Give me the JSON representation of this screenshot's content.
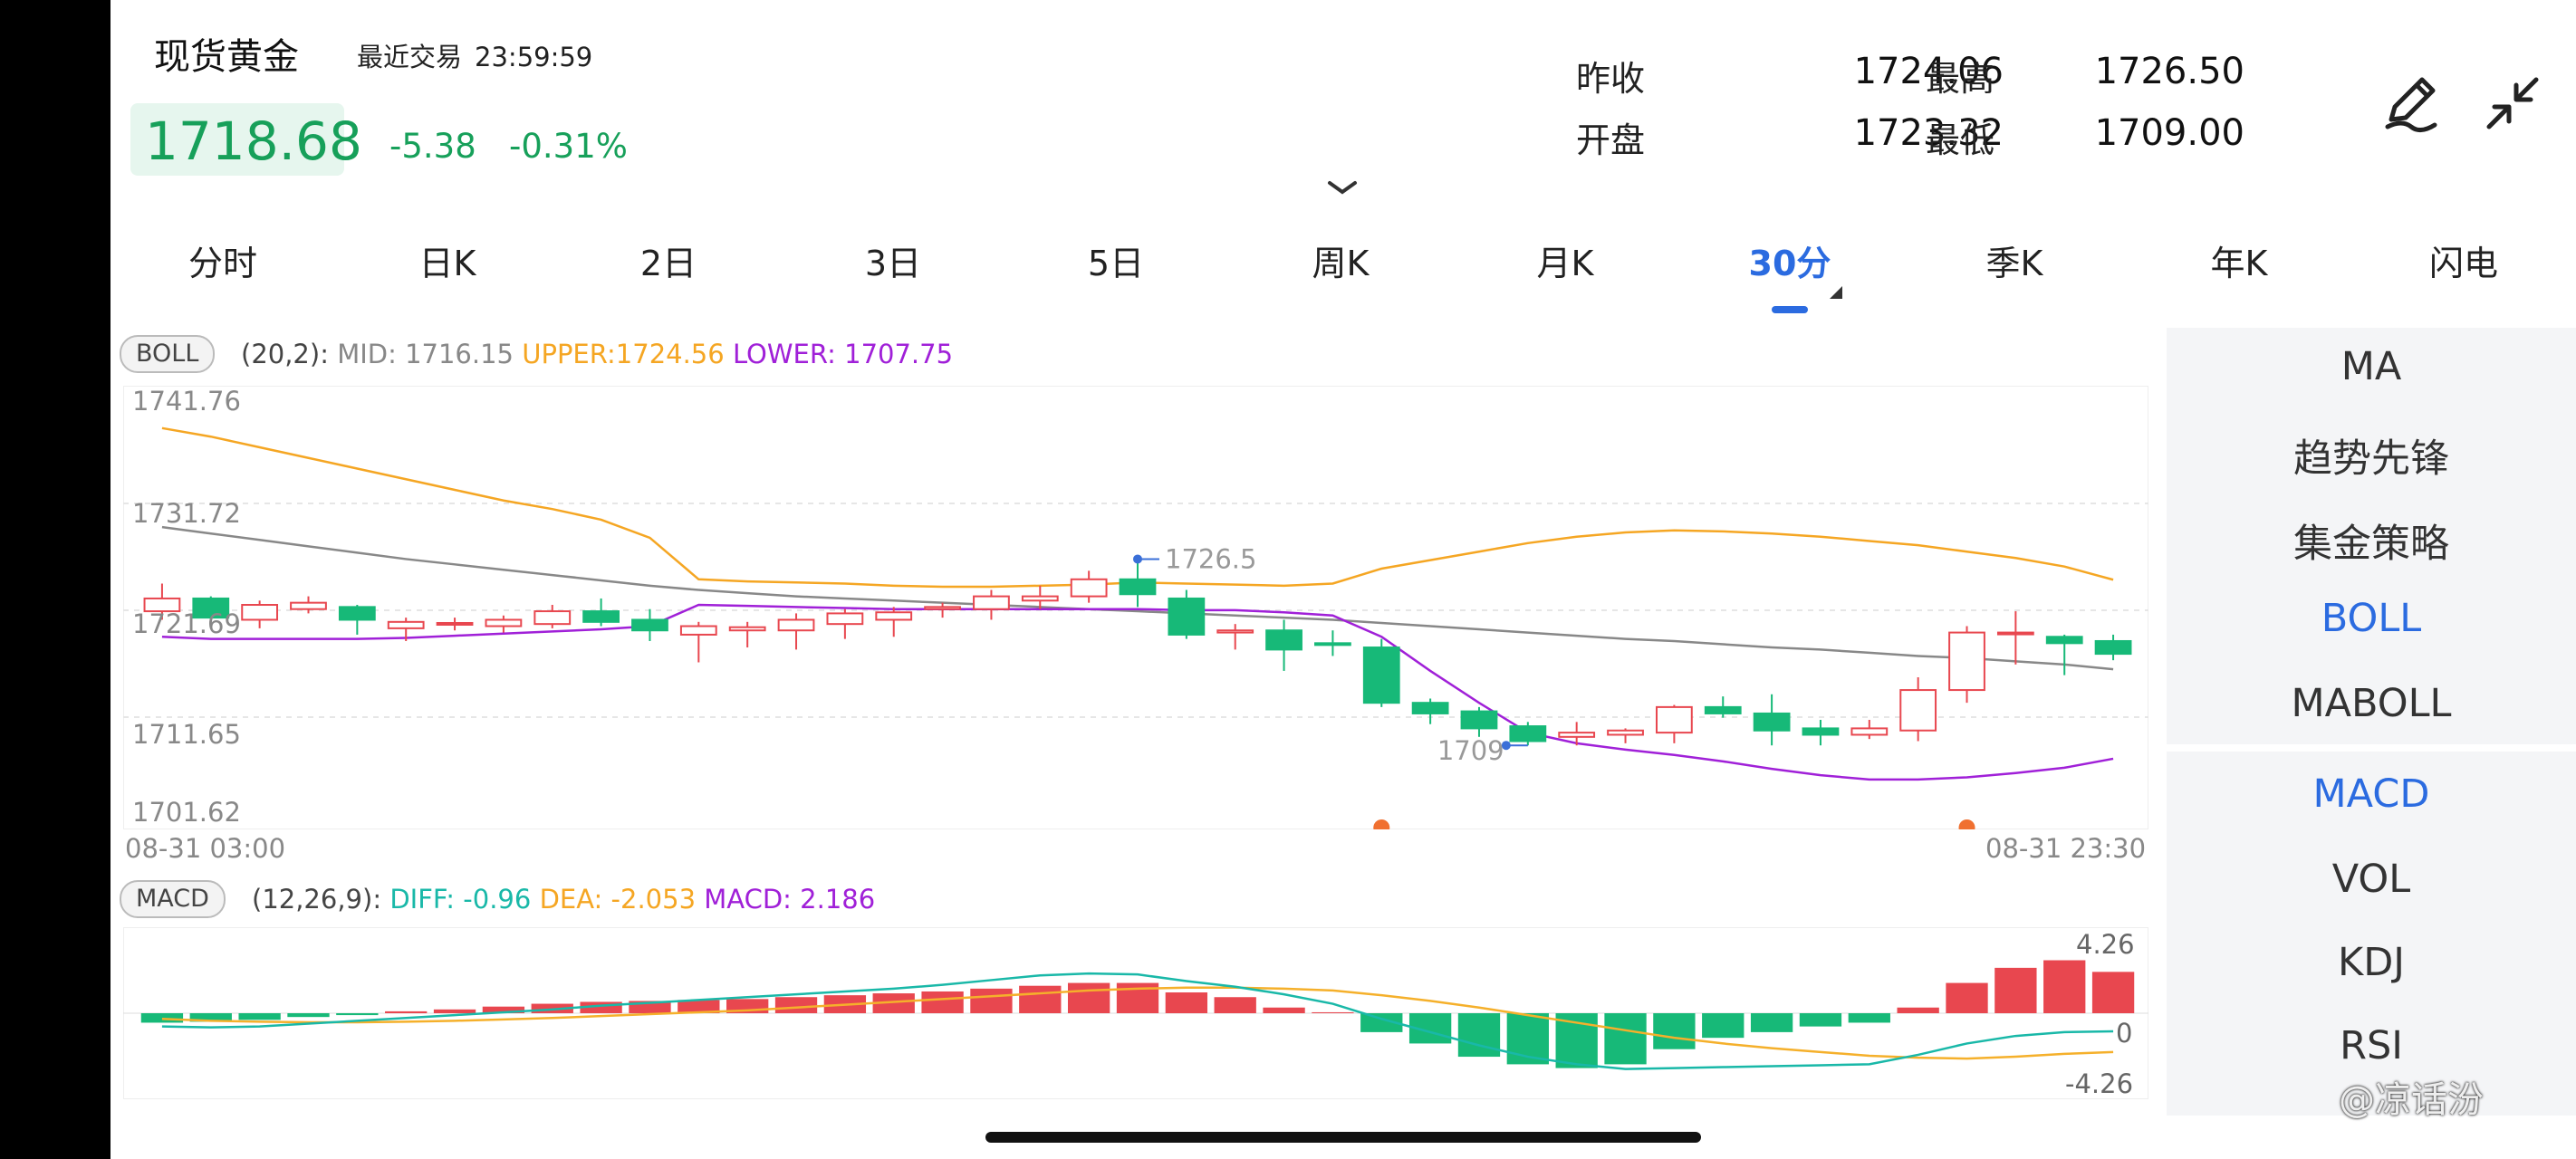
{
  "header": {
    "title": "现货黄金",
    "last_trade_label": "最近交易",
    "last_trade_time": "23:59:59",
    "price": "1718.68",
    "change": "-5.38",
    "change_pct": "-0.31%",
    "stats": {
      "prev_close_label": "昨收",
      "prev_close": "1724.06",
      "open_label": "开盘",
      "open": "1723.32",
      "high_label": "最高",
      "high": "1726.50",
      "low_label": "最低",
      "low": "1709.00"
    },
    "icons": [
      "pencil-draw-icon",
      "collapse-arrows-icon",
      "chevron-down-icon"
    ]
  },
  "tabs": [
    {
      "label": "分时"
    },
    {
      "label": "日K"
    },
    {
      "label": "2日"
    },
    {
      "label": "3日"
    },
    {
      "label": "5日"
    },
    {
      "label": "周K"
    },
    {
      "label": "月K"
    },
    {
      "label": "30分",
      "active": true
    },
    {
      "label": "季K"
    },
    {
      "label": "年K"
    },
    {
      "label": "闪电"
    }
  ],
  "boll_legend": {
    "tag": "BOLL",
    "params": "(20,2):",
    "mid": "MID: 1716.15",
    "upper": "UPPER:1724.56",
    "lower": "LOWER: 1707.75"
  },
  "macd_legend": {
    "tag": "MACD",
    "params": "(12,26,9):",
    "diff": "DIFF: -0.96",
    "dea": "DEA: -2.053",
    "macd": "MACD: 2.186"
  },
  "sidebar": {
    "main_indicators": [
      "MA",
      "趋势先锋",
      "集金策略",
      "BOLL",
      "MABOLL"
    ],
    "sub_indicators": [
      "MACD",
      "VOL",
      "KDJ",
      "RSI"
    ],
    "active_main": "BOLL",
    "active_sub": "MACD"
  },
  "watermark": "@凉话汾",
  "colors": {
    "up": "#e8474f",
    "down": "#17b978",
    "upper": "#f5a623",
    "mid": "#888888",
    "lower": "#a020d8",
    "accent": "#2b6be0",
    "diff": "#19b8a8",
    "dea": "#f5b02b"
  },
  "chart_data": [
    {
      "type": "candlestick",
      "ylim": [
        1701.62,
        1741.76
      ],
      "y_ticks": [
        "1741.76",
        "1731.72",
        "1721.69",
        "1711.65",
        "1701.62"
      ],
      "x_start_label": "08-31 03:00",
      "x_end_label": "08-31 23:30",
      "high_annotation": "1726.5",
      "low_annotation": "1709",
      "candles": [
        {
          "o": 1721.6,
          "c": 1722.8,
          "h": 1724.2,
          "l": 1720.8
        },
        {
          "o": 1722.8,
          "c": 1721.0,
          "h": 1723.0,
          "l": 1720.8
        },
        {
          "o": 1720.8,
          "c": 1722.2,
          "h": 1722.6,
          "l": 1720.0
        },
        {
          "o": 1721.8,
          "c": 1722.4,
          "h": 1723.0,
          "l": 1721.4
        },
        {
          "o": 1722.0,
          "c": 1720.8,
          "h": 1722.2,
          "l": 1719.4
        },
        {
          "o": 1720.0,
          "c": 1720.6,
          "h": 1721.0,
          "l": 1718.8
        },
        {
          "o": 1720.4,
          "c": 1720.5,
          "h": 1721.0,
          "l": 1719.8
        },
        {
          "o": 1720.2,
          "c": 1720.8,
          "h": 1721.2,
          "l": 1719.6
        },
        {
          "o": 1720.4,
          "c": 1721.6,
          "h": 1722.2,
          "l": 1720.0
        },
        {
          "o": 1721.6,
          "c": 1720.6,
          "h": 1722.8,
          "l": 1720.2
        },
        {
          "o": 1720.8,
          "c": 1719.8,
          "h": 1721.8,
          "l": 1718.8
        },
        {
          "o": 1719.4,
          "c": 1720.2,
          "h": 1720.6,
          "l": 1716.8
        },
        {
          "o": 1719.8,
          "c": 1720.1,
          "h": 1720.6,
          "l": 1718.2
        },
        {
          "o": 1719.8,
          "c": 1720.8,
          "h": 1721.4,
          "l": 1718.0
        },
        {
          "o": 1720.4,
          "c": 1721.4,
          "h": 1721.8,
          "l": 1719.0
        },
        {
          "o": 1720.8,
          "c": 1721.5,
          "h": 1722.0,
          "l": 1719.2
        },
        {
          "o": 1721.8,
          "c": 1722.0,
          "h": 1722.4,
          "l": 1721.0
        },
        {
          "o": 1721.8,
          "c": 1723.0,
          "h": 1723.6,
          "l": 1720.8
        },
        {
          "o": 1722.6,
          "c": 1723.0,
          "h": 1724.0,
          "l": 1721.8
        },
        {
          "o": 1723.0,
          "c": 1724.6,
          "h": 1725.4,
          "l": 1722.4
        },
        {
          "o": 1724.6,
          "c": 1723.2,
          "h": 1726.5,
          "l": 1722.0
        },
        {
          "o": 1722.8,
          "c": 1719.4,
          "h": 1723.6,
          "l": 1719.0
        },
        {
          "o": 1719.6,
          "c": 1719.8,
          "h": 1720.4,
          "l": 1718.0
        },
        {
          "o": 1719.8,
          "c": 1718.0,
          "h": 1720.8,
          "l": 1716.0
        },
        {
          "o": 1718.6,
          "c": 1718.5,
          "h": 1719.8,
          "l": 1717.4
        },
        {
          "o": 1718.2,
          "c": 1713.0,
          "h": 1719.0,
          "l": 1712.6
        },
        {
          "o": 1713.0,
          "c": 1712.0,
          "h": 1713.4,
          "l": 1711.0
        },
        {
          "o": 1712.2,
          "c": 1710.6,
          "h": 1712.6,
          "l": 1709.8
        },
        {
          "o": 1710.8,
          "c": 1709.4,
          "h": 1711.2,
          "l": 1709.0
        },
        {
          "o": 1709.8,
          "c": 1710.2,
          "h": 1711.2,
          "l": 1709.0
        },
        {
          "o": 1710.0,
          "c": 1710.4,
          "h": 1710.6,
          "l": 1709.2
        },
        {
          "o": 1710.2,
          "c": 1712.6,
          "h": 1712.8,
          "l": 1709.2
        },
        {
          "o": 1712.6,
          "c": 1712.0,
          "h": 1713.6,
          "l": 1711.6
        },
        {
          "o": 1712.0,
          "c": 1710.4,
          "h": 1713.8,
          "l": 1709.0
        },
        {
          "o": 1710.6,
          "c": 1710.0,
          "h": 1711.4,
          "l": 1709.0
        },
        {
          "o": 1710.0,
          "c": 1710.6,
          "h": 1711.4,
          "l": 1709.6
        },
        {
          "o": 1710.4,
          "c": 1714.2,
          "h": 1715.4,
          "l": 1709.4
        },
        {
          "o": 1714.2,
          "c": 1719.6,
          "h": 1720.2,
          "l": 1713.0
        },
        {
          "o": 1719.6,
          "c": 1719.6,
          "h": 1721.6,
          "l": 1716.6
        },
        {
          "o": 1719.2,
          "c": 1718.6,
          "h": 1719.4,
          "l": 1715.6
        },
        {
          "o": 1718.8,
          "c": 1717.6,
          "h": 1719.4,
          "l": 1717.0
        }
      ],
      "upper": [
        1738.8,
        1738.0,
        1737.0,
        1736.0,
        1735.0,
        1734.0,
        1733.0,
        1732.0,
        1731.2,
        1730.2,
        1728.5,
        1724.6,
        1724.4,
        1724.3,
        1724.2,
        1724.0,
        1723.9,
        1723.9,
        1724.0,
        1724.1,
        1724.3,
        1724.2,
        1724.1,
        1724.0,
        1724.2,
        1725.6,
        1726.4,
        1727.2,
        1728.0,
        1728.6,
        1729.0,
        1729.2,
        1729.1,
        1728.9,
        1728.6,
        1728.2,
        1727.8,
        1727.2,
        1726.6,
        1725.8,
        1724.56
      ],
      "mid": [
        1729.5,
        1728.9,
        1728.3,
        1727.7,
        1727.1,
        1726.5,
        1726.0,
        1725.5,
        1725.0,
        1724.5,
        1724.0,
        1723.6,
        1723.3,
        1723.0,
        1722.8,
        1722.6,
        1722.4,
        1722.2,
        1722.0,
        1721.8,
        1721.6,
        1721.4,
        1721.2,
        1721.0,
        1720.8,
        1720.5,
        1720.2,
        1719.9,
        1719.6,
        1719.3,
        1719.0,
        1718.8,
        1718.5,
        1718.2,
        1718.0,
        1717.7,
        1717.4,
        1717.2,
        1716.9,
        1716.6,
        1716.15
      ],
      "lower": [
        1719.2,
        1719.0,
        1719.0,
        1719.0,
        1719.0,
        1719.1,
        1719.3,
        1719.5,
        1719.7,
        1719.9,
        1720.2,
        1722.2,
        1722.1,
        1722.0,
        1721.9,
        1721.8,
        1721.8,
        1721.8,
        1721.8,
        1721.8,
        1721.8,
        1721.7,
        1721.7,
        1721.5,
        1721.2,
        1719.2,
        1716.0,
        1713.0,
        1710.2,
        1709.2,
        1708.6,
        1708.1,
        1707.5,
        1706.8,
        1706.2,
        1705.8,
        1705.8,
        1706.0,
        1706.4,
        1706.9,
        1707.75
      ]
    },
    {
      "type": "bar",
      "name": "MACD",
      "ylim": [
        -4.26,
        4.26
      ],
      "y_ticks": [
        "4.26",
        "0",
        "-4.26"
      ],
      "values": [
        -0.5,
        -0.45,
        -0.35,
        -0.2,
        -0.1,
        0.1,
        0.2,
        0.35,
        0.5,
        0.6,
        0.65,
        0.7,
        0.75,
        0.85,
        0.95,
        1.05,
        1.15,
        1.3,
        1.45,
        1.6,
        1.6,
        1.1,
        0.85,
        0.3,
        0.05,
        -1.0,
        -1.6,
        -2.3,
        -2.7,
        -2.9,
        -2.7,
        -1.9,
        -1.3,
        -1.0,
        -0.7,
        -0.5,
        0.3,
        1.6,
        2.4,
        2.8,
        2.186
      ],
      "diff": [
        -0.7,
        -0.75,
        -0.7,
        -0.55,
        -0.4,
        -0.25,
        -0.1,
        0.05,
        0.2,
        0.4,
        0.55,
        0.7,
        0.85,
        1.0,
        1.15,
        1.3,
        1.5,
        1.75,
        2.0,
        2.1,
        2.05,
        1.7,
        1.4,
        1.0,
        0.5,
        -0.3,
        -1.0,
        -1.7,
        -2.3,
        -2.7,
        -2.95,
        -2.9,
        -2.85,
        -2.8,
        -2.75,
        -2.7,
        -2.2,
        -1.6,
        -1.2,
        -1.0,
        -0.96
      ],
      "dea": [
        -0.3,
        -0.4,
        -0.45,
        -0.48,
        -0.48,
        -0.45,
        -0.4,
        -0.33,
        -0.25,
        -0.15,
        -0.05,
        0.05,
        0.15,
        0.3,
        0.45,
        0.6,
        0.75,
        0.9,
        1.05,
        1.2,
        1.3,
        1.35,
        1.35,
        1.3,
        1.2,
        0.95,
        0.65,
        0.3,
        -0.1,
        -0.5,
        -0.9,
        -1.3,
        -1.6,
        -1.85,
        -2.05,
        -2.25,
        -2.35,
        -2.4,
        -2.3,
        -2.15,
        -2.053
      ]
    }
  ]
}
